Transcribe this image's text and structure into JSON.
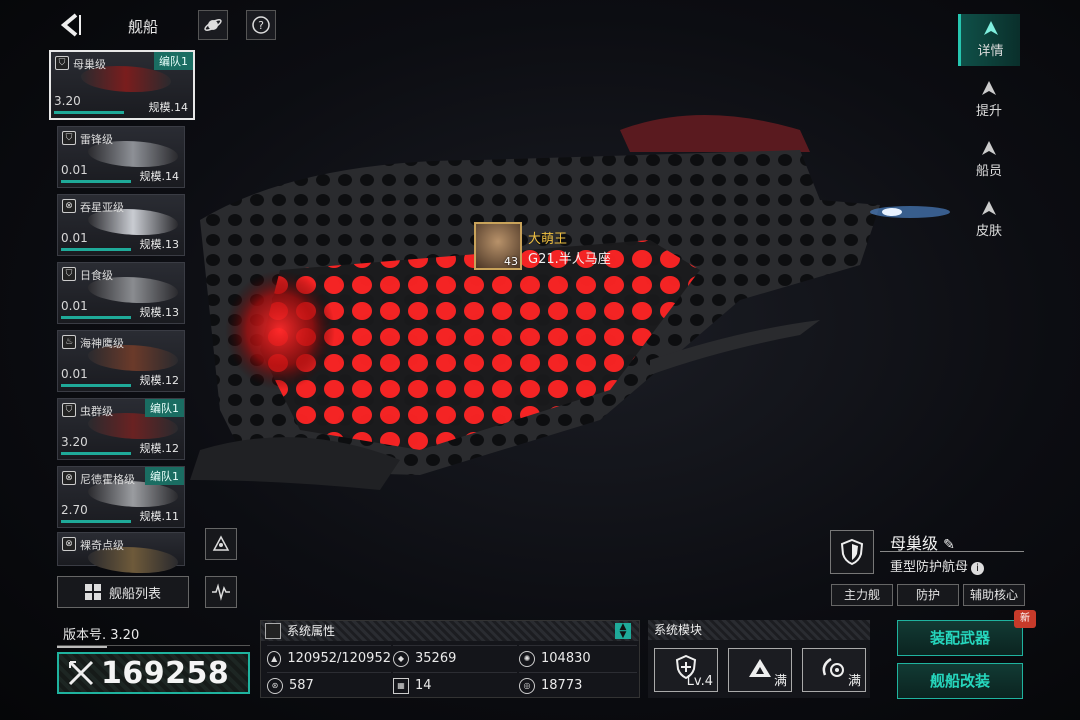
{
  "header": {
    "title": "舰船",
    "back_icon": "chevron-left-icon",
    "galaxy_icon": "planet-icon",
    "help_icon": "help-icon"
  },
  "ship_list": [
    {
      "class": "母巢级",
      "version": "3.20",
      "scale": "规模.14",
      "fleet": "编队1",
      "selected": true,
      "icon": "shield"
    },
    {
      "class": "雷锋级",
      "version": "0.01",
      "scale": "规模.14",
      "fleet": "",
      "selected": false,
      "icon": "shield"
    },
    {
      "class": "吞星亚级",
      "version": "0.01",
      "scale": "规模.13",
      "fleet": "",
      "selected": false,
      "icon": "target"
    },
    {
      "class": "日食级",
      "version": "0.01",
      "scale": "规模.13",
      "fleet": "",
      "selected": false,
      "icon": "shield"
    },
    {
      "class": "海神鹰级",
      "version": "0.01",
      "scale": "规模.12",
      "fleet": "",
      "selected": false,
      "icon": "flame"
    },
    {
      "class": "虫群级",
      "version": "3.20",
      "scale": "规模.12",
      "fleet": "编队1",
      "selected": false,
      "icon": "shield"
    },
    {
      "class": "尼德霍格级",
      "version": "2.70",
      "scale": "规模.11",
      "fleet": "编队1",
      "selected": false,
      "icon": "target"
    },
    {
      "class": "裸奇点级",
      "version": "",
      "scale": "",
      "fleet": "",
      "selected": false,
      "icon": "target"
    }
  ],
  "list_button": {
    "label": "舰船列表"
  },
  "right_tabs": [
    {
      "label": "详情",
      "active": true
    },
    {
      "label": "提升",
      "active": false
    },
    {
      "label": "船员",
      "active": false
    },
    {
      "label": "皮肤",
      "active": false
    }
  ],
  "player": {
    "name": "大萌王",
    "server": "G21.半人马座",
    "level": "43"
  },
  "ship_info": {
    "name": "母巢级",
    "type": "重型防护航母",
    "info_icon": "i",
    "tags": [
      "主力舰",
      "防护",
      "辅助核心"
    ]
  },
  "version": {
    "label": "版本号. 3.20"
  },
  "power": {
    "value": "169258",
    "icon": "crossed-swords-icon"
  },
  "attributes": {
    "title": "系统属性",
    "values": [
      "120952/120952",
      "35269",
      "104830",
      "587",
      "14",
      "18773"
    ]
  },
  "modules": {
    "title": "系统模块",
    "items": [
      {
        "label": "Lv.4",
        "icon": "shield-plus-icon"
      },
      {
        "label": "满",
        "icon": "triangle-icon"
      },
      {
        "label": "满",
        "icon": "gear-rotate-icon"
      }
    ]
  },
  "actions": {
    "equip": "装配武器",
    "modify": "舰船改装",
    "new_badge": "新"
  },
  "colors": {
    "accent": "#1fb39f",
    "player_name": "#f0c040",
    "new_badge": "#c73a2a"
  }
}
